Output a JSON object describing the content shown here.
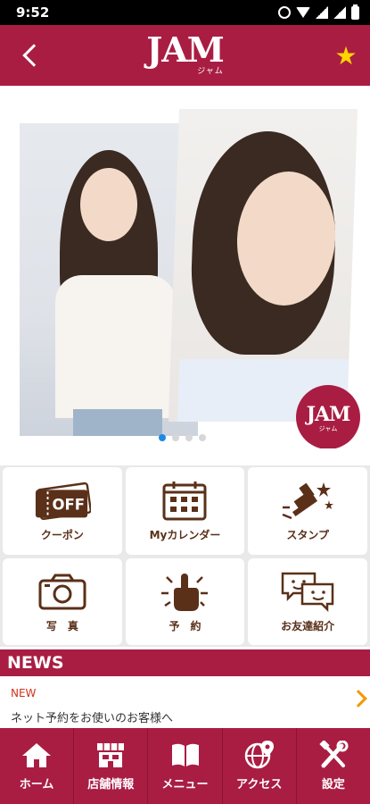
{
  "status_bar": {
    "time": "9:52"
  },
  "header": {
    "logo_text": "JAM",
    "logo_sub": "ジャム"
  },
  "banner": {
    "badge_text": "JAM",
    "badge_sub": "ジャム",
    "page_count": 4,
    "active_page": 1
  },
  "menu": [
    {
      "label": "クーポン",
      "icon": "coupon-icon",
      "icon_text": "OFF"
    },
    {
      "label": "Myカレンダー",
      "icon": "calendar-icon"
    },
    {
      "label": "スタンプ",
      "icon": "stamp-icon"
    },
    {
      "label": "写　真",
      "icon": "camera-icon"
    },
    {
      "label": "予　約",
      "icon": "reserve-icon"
    },
    {
      "label": "お友達紹介",
      "icon": "friend-referral-icon"
    }
  ],
  "news": {
    "title": "NEWS",
    "items": [
      {
        "badge": "NEW",
        "text": "ネット予約をお使いのお客様へ"
      }
    ]
  },
  "bottom_nav": [
    {
      "label": "ホーム",
      "icon": "home-icon"
    },
    {
      "label": "店舗情報",
      "icon": "shop-icon"
    },
    {
      "label": "メニュー",
      "icon": "book-icon"
    },
    {
      "label": "アクセス",
      "icon": "globe-pin-icon"
    },
    {
      "label": "設定",
      "icon": "tools-icon"
    }
  ],
  "colors": {
    "brand": "#a91d43",
    "tile_text": "#5a3019",
    "new_badge": "#d0321a",
    "arrow": "#f39800",
    "star": "#ffd400"
  }
}
